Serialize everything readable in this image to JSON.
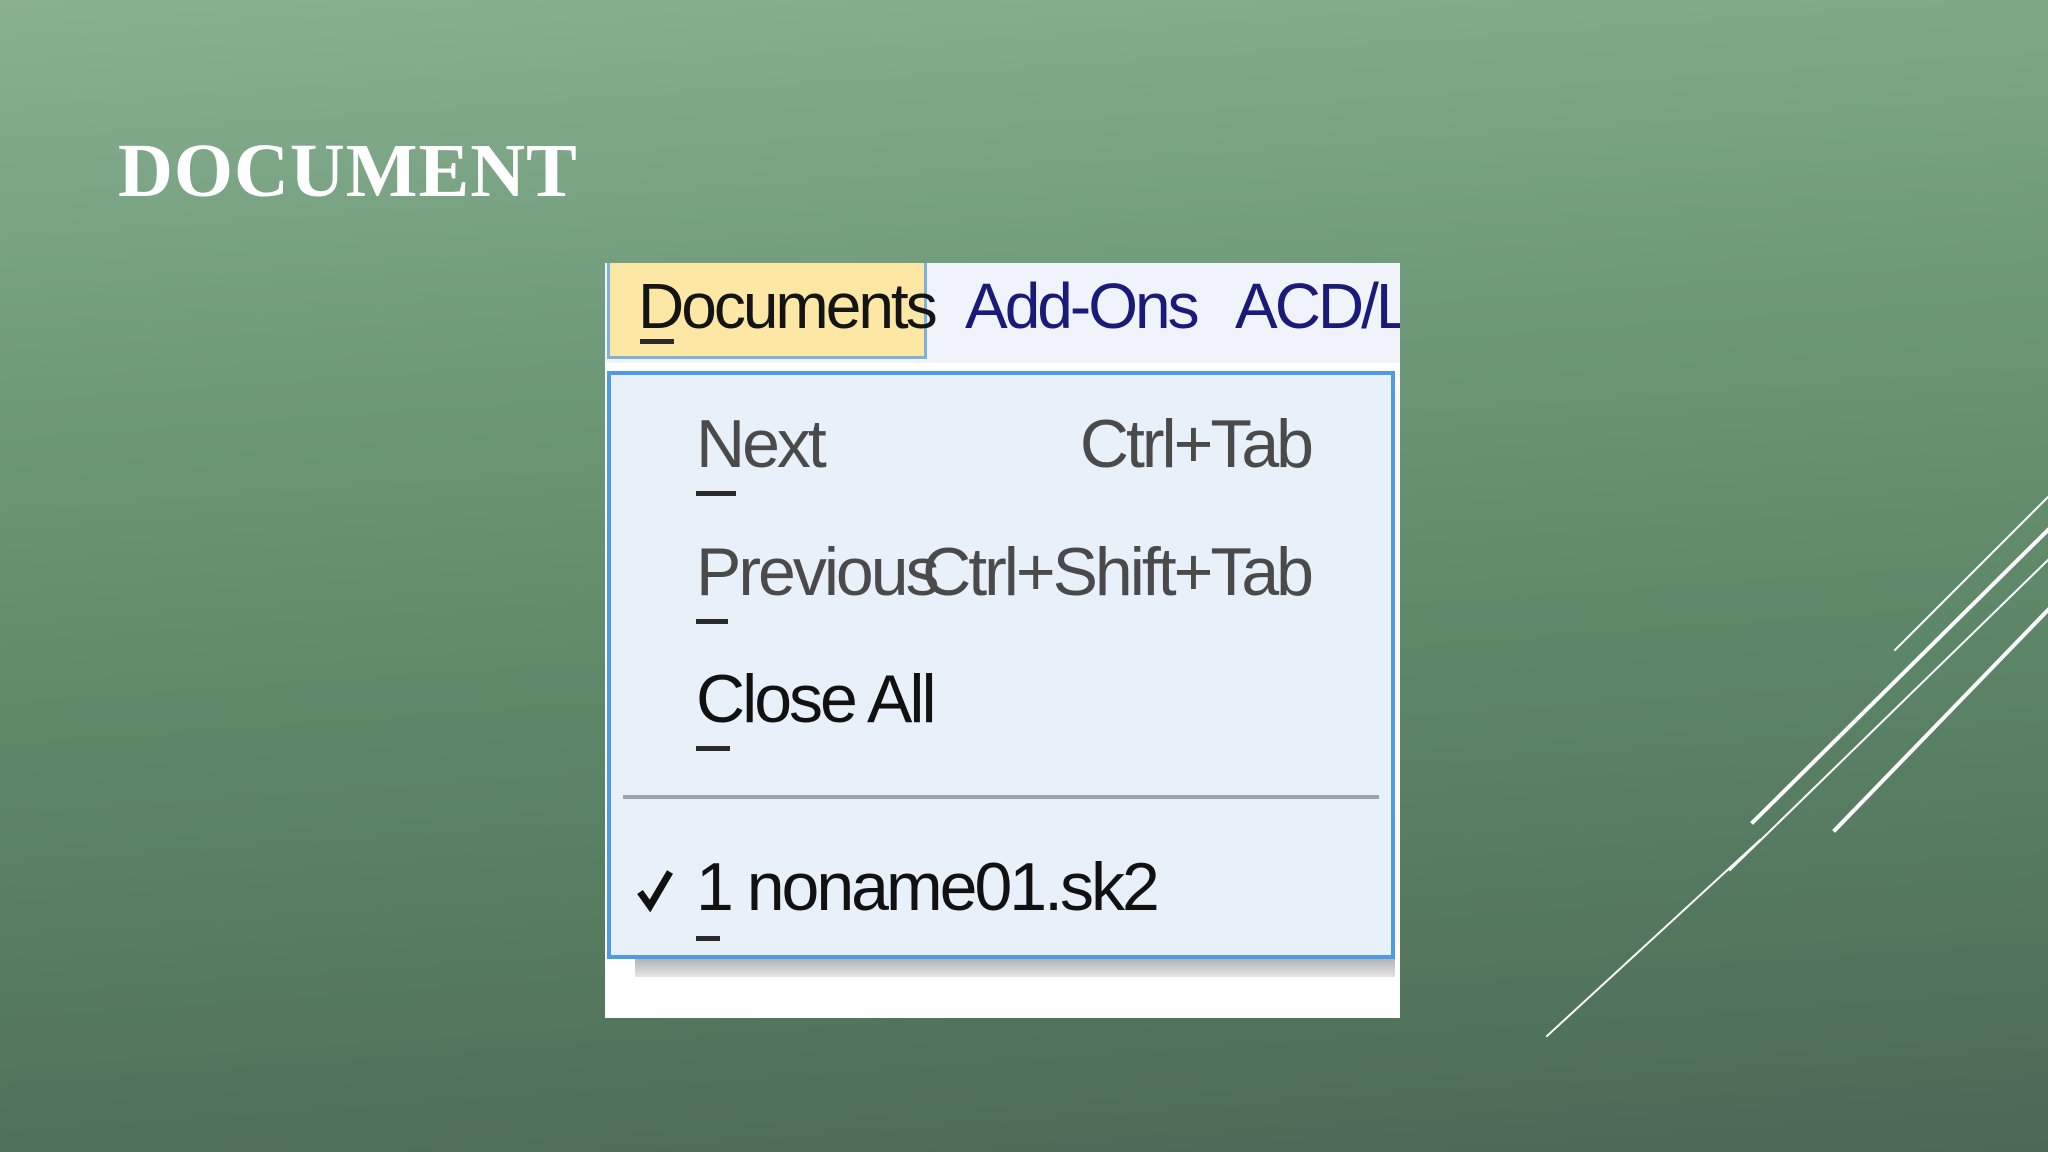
{
  "slide": {
    "title": "DOCUMENT"
  },
  "menubar": {
    "items": [
      {
        "label": "Documents",
        "active": true
      },
      {
        "label": "Add-Ons",
        "active": false
      },
      {
        "label": "ACD/La",
        "active": false
      }
    ]
  },
  "dropdown": {
    "items": [
      {
        "label": "Next",
        "shortcut": "Ctrl+Tab"
      },
      {
        "label": "Previous",
        "shortcut": "Ctrl+Shift+Tab"
      },
      {
        "label": "Close All",
        "shortcut": ""
      }
    ],
    "documents": [
      {
        "label": "1 noname01.sk2",
        "checked": true,
        "icon": "check-icon"
      }
    ]
  },
  "colors": {
    "menubar_active": "#fde7a4",
    "dropdown_border": "#4d9be6",
    "dropdown_bg": "#e8f0fa"
  }
}
